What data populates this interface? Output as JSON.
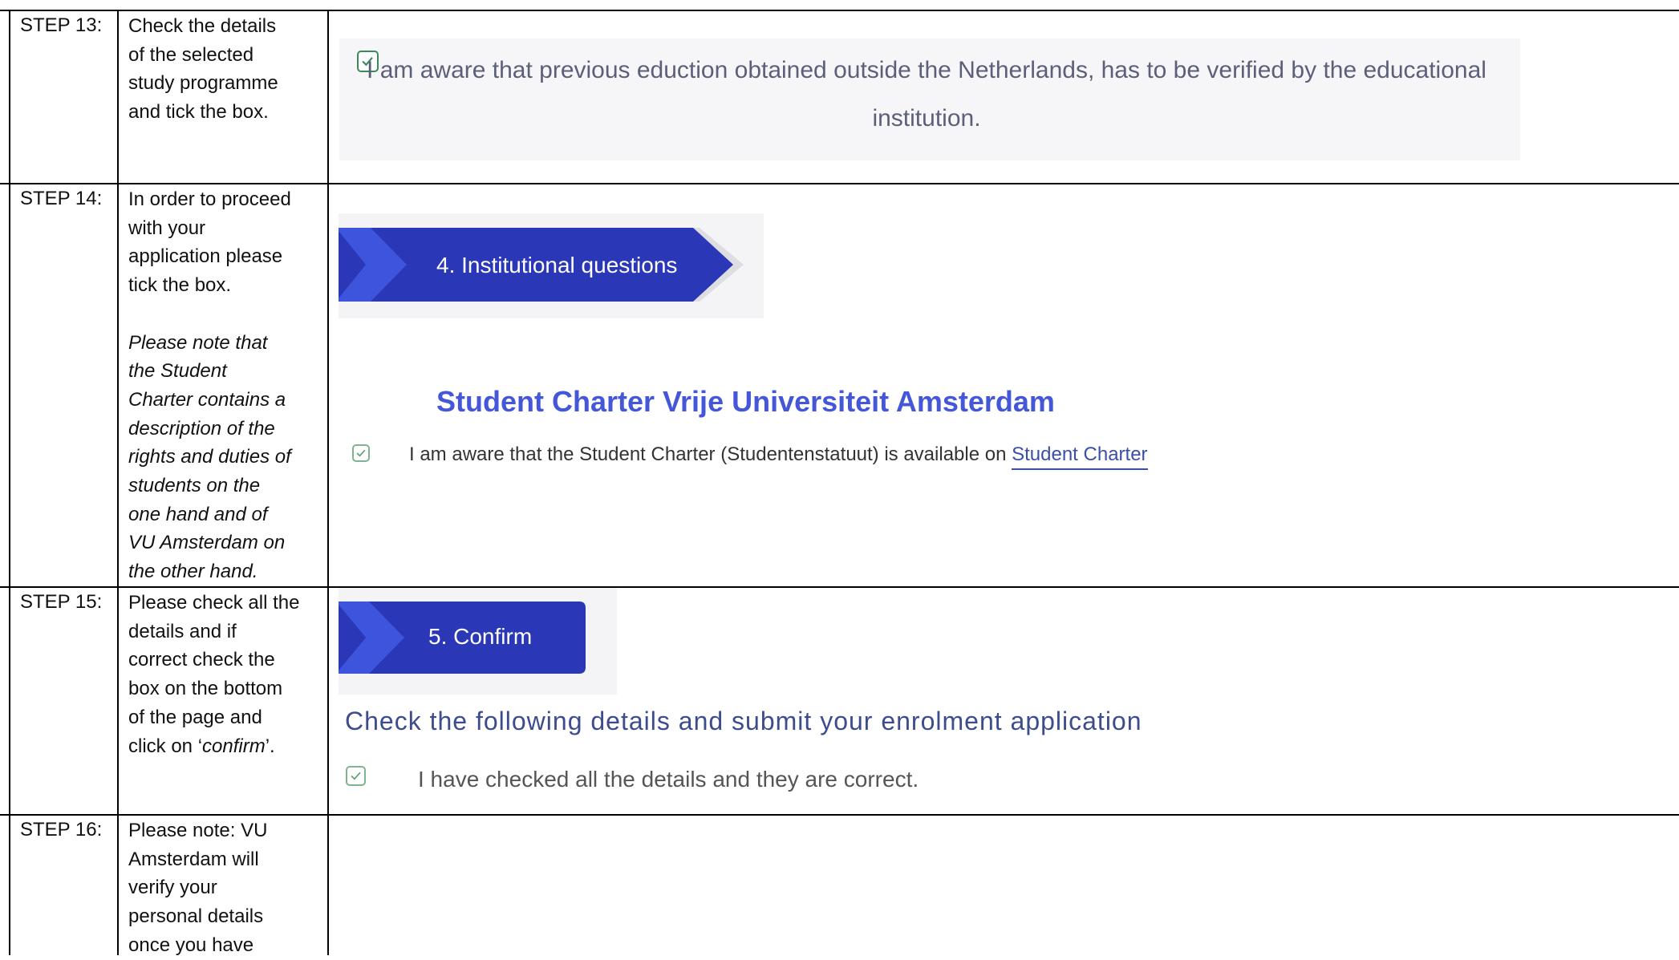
{
  "steps": [
    {
      "label": "STEP 13:",
      "lines": [
        "Check the details",
        "of the selected",
        "study programme",
        "and tick the box."
      ]
    },
    {
      "label": "STEP 14:",
      "lines": [
        "In order to proceed",
        "with your",
        "application please",
        "tick the box."
      ],
      "note_lines": [
        "Please note that",
        "the Student",
        "Charter contains a",
        "description of the",
        "rights and duties of",
        "students on the",
        "one hand and of",
        "VU Amsterdam on",
        "the other hand."
      ]
    },
    {
      "label": "STEP 15:",
      "lines_before": [
        "Please check all the",
        "details and if",
        "correct check the",
        "box on the bottom",
        "of the page and"
      ],
      "last_line_prefix": "click on ‘",
      "last_line_em": "confirm",
      "last_line_suffix": "’."
    },
    {
      "label": "STEP 16:",
      "lines": [
        "Please note: VU",
        "Amsterdam will",
        "verify your",
        "personal details",
        "once you have"
      ]
    }
  ],
  "step13_screenshot": {
    "awareness_text": "I am aware that previous eduction obtained outside the Netherlands, has to be verified by the educational institution.",
    "checked": true
  },
  "step14_screenshot": {
    "tab_label": "4. Institutional questions",
    "charter_title": "Student Charter Vrije Universiteit Amsterdam",
    "charter_text": "I am aware that the Student Charter (Studentenstatuut) is available on",
    "charter_link": "Student Charter",
    "checked": true
  },
  "step15_screenshot": {
    "tab_label": "5. Confirm",
    "heading": "Check the following details and submit your enrolment application",
    "checkbox_text": "I have checked all the details and they are correct.",
    "checked": true
  },
  "colors": {
    "tab_blue": "#2a37b6",
    "chevron_blue": "#3d55dc",
    "title_blue": "#4457d8",
    "check_green": "#3a8a5a"
  }
}
